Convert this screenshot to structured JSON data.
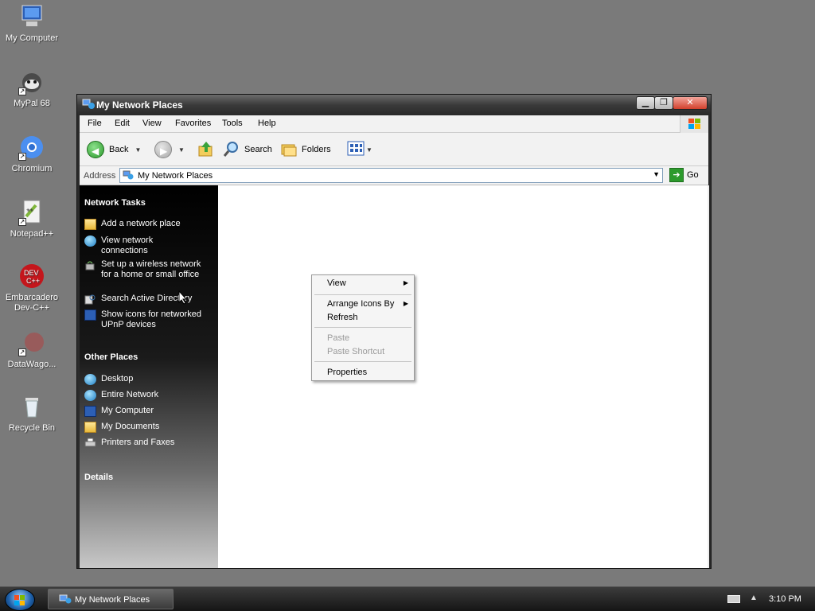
{
  "desktop": {
    "icons": [
      {
        "label": "My Computer",
        "icon": "computer-icon"
      },
      {
        "label": "MyPal 68",
        "icon": "mypal-icon"
      },
      {
        "label": "Chromium",
        "icon": "chromium-icon"
      },
      {
        "label": "Notepad++",
        "icon": "notepadpp-icon"
      },
      {
        "label": "Embarcadero Dev-C++",
        "icon": "devcpp-icon"
      },
      {
        "label": "DataWago...",
        "icon": "datawagon-icon"
      },
      {
        "label": "Recycle Bin",
        "icon": "recycle-bin-icon"
      }
    ]
  },
  "window": {
    "title": "My Network Places",
    "controls": {
      "minimize": "▁",
      "maximize": "❐",
      "close": "✕"
    },
    "menu": [
      "File",
      "Edit",
      "View",
      "Favorites",
      "Tools",
      "Help"
    ],
    "toolbar": {
      "back": "Back",
      "search": "Search",
      "folders": "Folders"
    },
    "address": {
      "label": "Address",
      "value": "My Network Places",
      "go": "Go"
    },
    "sidebar": {
      "network_tasks": {
        "title": "Network Tasks",
        "items": [
          "Add a network place",
          "View network connections",
          "Set up a wireless network for a home or small office",
          "Search Active Directory",
          "Show icons for networked UPnP devices"
        ]
      },
      "other_places": {
        "title": "Other Places",
        "items": [
          "Desktop",
          "Entire Network",
          "My Computer",
          "My Documents",
          "Printers and Faxes"
        ]
      },
      "details": {
        "title": "Details"
      }
    }
  },
  "context_menu": {
    "items": [
      {
        "label": "View",
        "submenu": true,
        "disabled": false
      },
      {
        "label": "Arrange Icons By",
        "submenu": true,
        "disabled": false
      },
      {
        "label": "Refresh",
        "submenu": false,
        "disabled": false
      },
      {
        "label": "Paste",
        "submenu": false,
        "disabled": true
      },
      {
        "label": "Paste Shortcut",
        "submenu": false,
        "disabled": true
      },
      {
        "label": "Properties",
        "submenu": false,
        "disabled": false
      }
    ]
  },
  "taskbar": {
    "task": "My Network Places",
    "clock": "3:10 PM"
  },
  "colors": {
    "desktop_bg": "#7a7a7a",
    "title_bar": "#3a3a3a",
    "sidebar_top": "#000000",
    "accent_green": "#2c9a2c"
  }
}
